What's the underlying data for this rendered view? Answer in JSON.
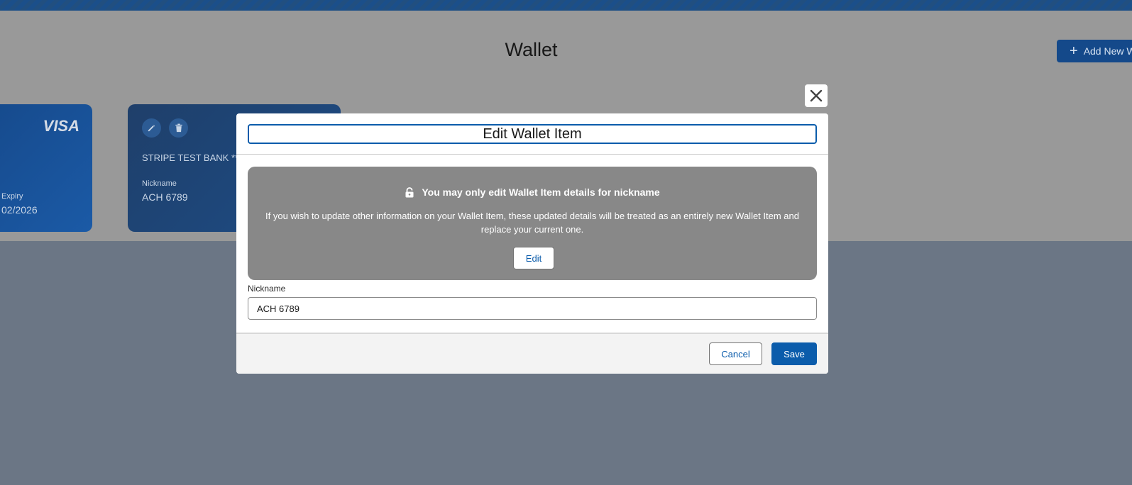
{
  "page": {
    "title": "Wallet",
    "add_button_label": "Add New W",
    "add_icon": "plus-icon"
  },
  "cards": {
    "visa": {
      "brand": "VISA",
      "expiry_label": "Expiry",
      "expiry_value": "02/2026"
    },
    "bank": {
      "bank_name": "STRIPE TEST BANK **",
      "nickname_label": "Nickname",
      "nickname_value": "ACH 6789",
      "edit_icon": "pencil-icon",
      "delete_icon": "trash-icon"
    }
  },
  "modal": {
    "close_icon": "close-icon",
    "title": "Edit Wallet Item",
    "notice": {
      "icon": "lock-icon",
      "heading": "You may only edit Wallet Item details for nickname",
      "text": "If you wish to update other information on your Wallet Item, these updated details will be treated as an entirely new Wallet Item and replace your current one.",
      "edit_label": "Edit"
    },
    "nickname_label": "Nickname",
    "nickname_value": "ACH 6789",
    "cancel_label": "Cancel",
    "save_label": "Save"
  },
  "colors": {
    "brand_blue": "#0b5cab",
    "overlay": "#6b7685",
    "notice_bg": "#888888"
  }
}
